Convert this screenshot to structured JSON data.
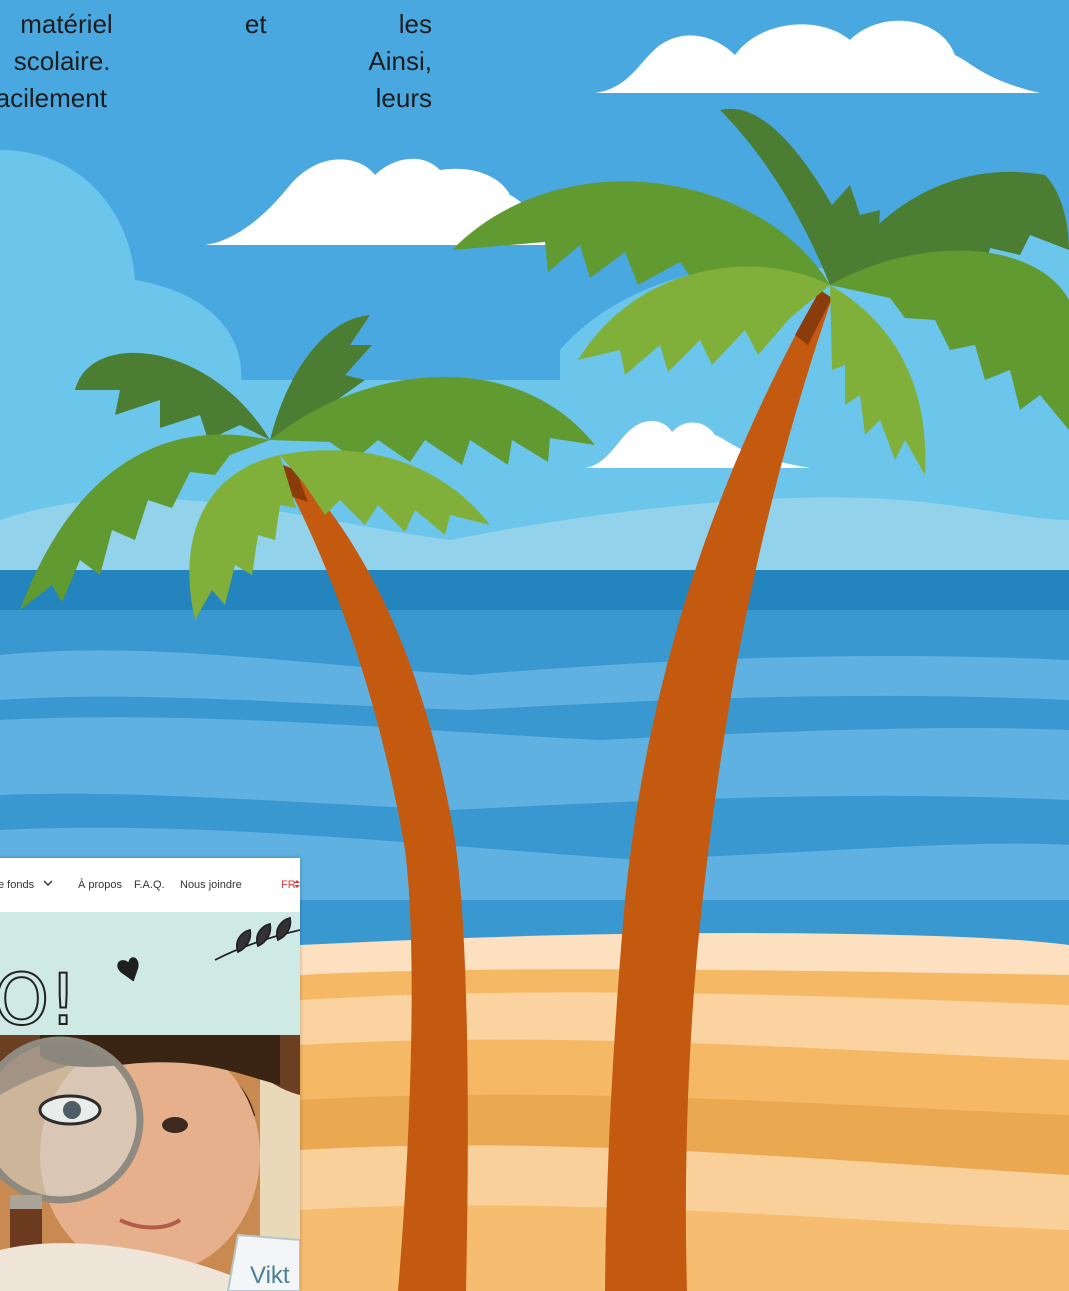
{
  "intro": {
    "line1": "ntifier le matériel et les",
    "line2": "rentrée scolaire. Ainsi,",
    "line3": "plus facilement leurs"
  },
  "embedded_site": {
    "nav": {
      "fonds_label": "e fonds",
      "fonds_icon": "chevron-down-icon",
      "apropos_label": "À propos",
      "faq_label": "F.A.Q.",
      "contact_label": "Nous joindre",
      "language_label": "FR",
      "language_icon": "updown-caret-icon"
    },
    "hero_text": "O!",
    "tag_text": "Vikt"
  },
  "colors": {
    "sky": "#4aa8e0",
    "sea": "#2484bd",
    "sand": "#f8c88a",
    "trunk": "#c45a10",
    "leaf_dark": "#4b7e33",
    "leaf_mid": "#619a31",
    "leaf_light": "#80b03a",
    "nav_language": "#d63a3a",
    "hero_background": "#cfe9e5"
  }
}
